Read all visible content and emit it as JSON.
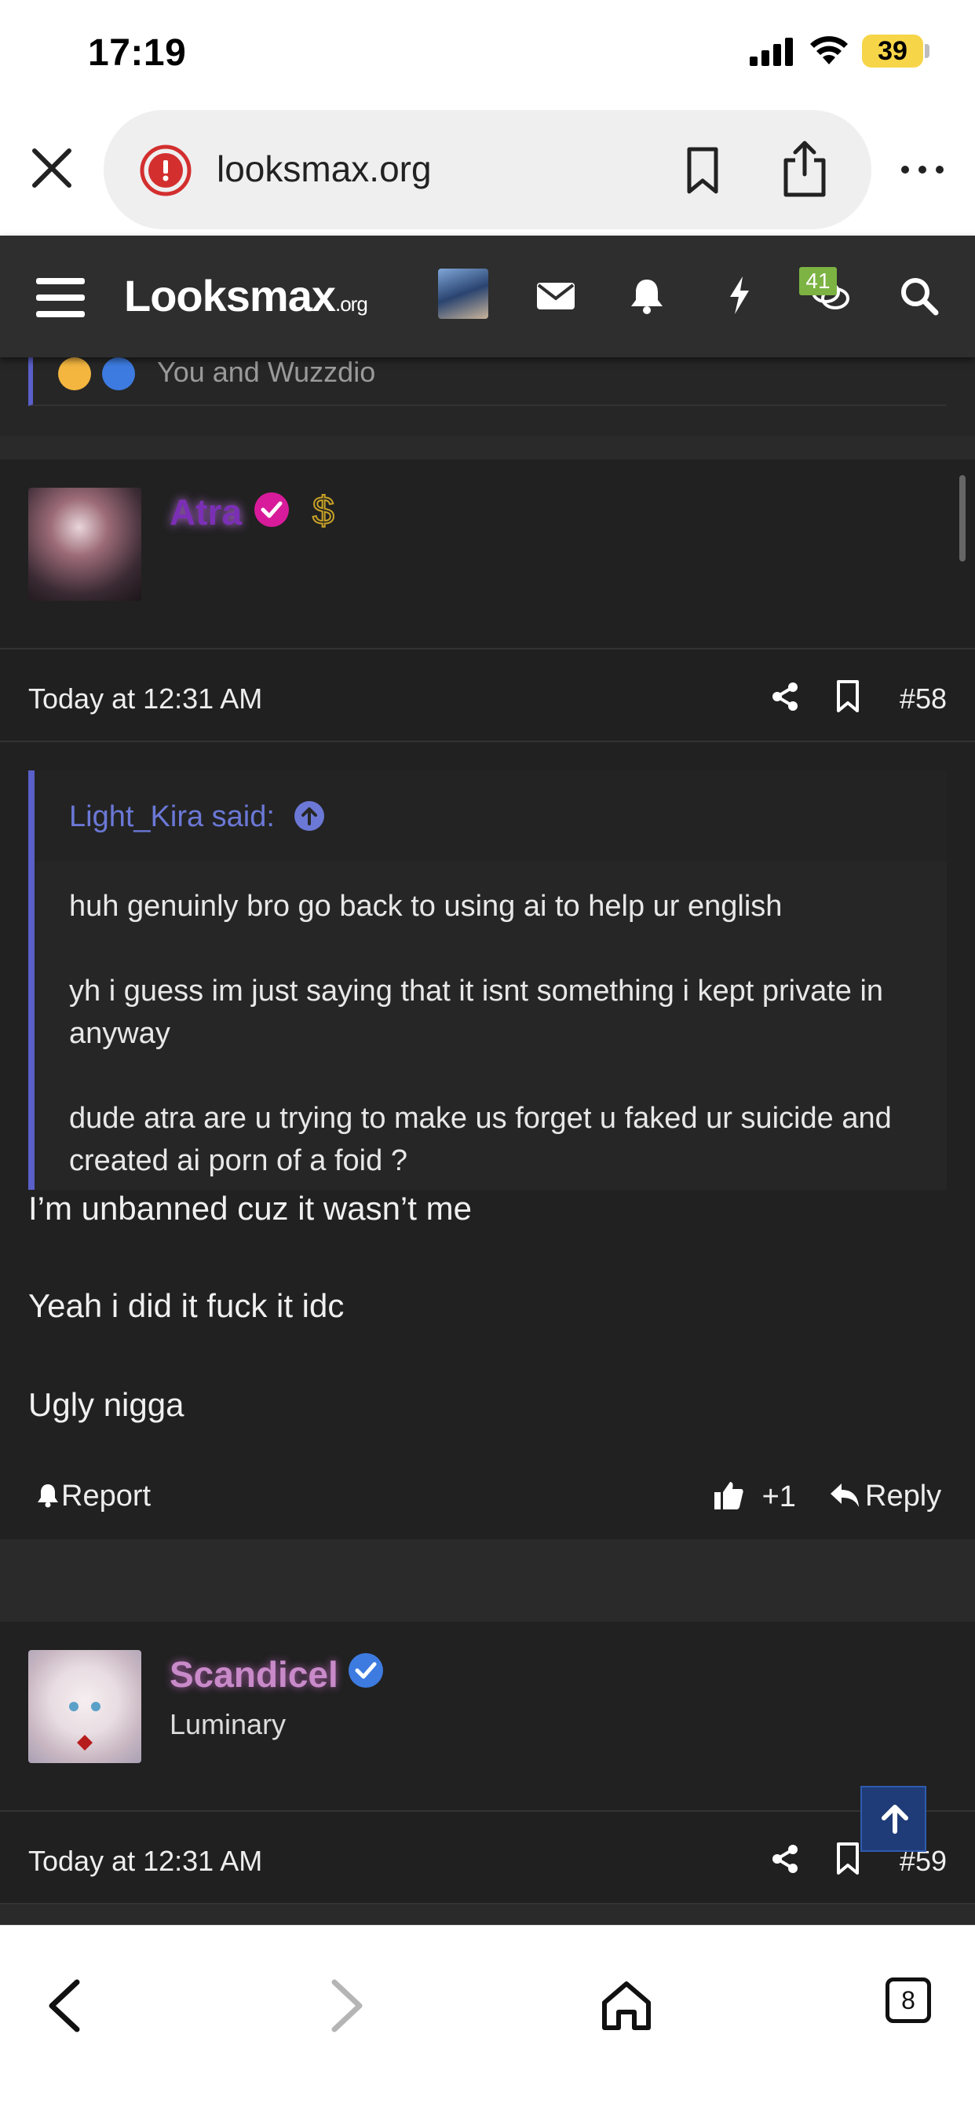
{
  "status_bar": {
    "time": "17:19",
    "battery": "39"
  },
  "browser": {
    "url": "looksmax.org"
  },
  "site": {
    "logo_main": "Looksmax",
    "logo_suffix": ".org",
    "conversations_badge": "41"
  },
  "previous_post": {
    "reactions_text": "You and Wuzzdio"
  },
  "posts": [
    {
      "username": "Atra",
      "user_title": "",
      "date": "Today at 12:31 AM",
      "post_number": "#58",
      "quote": {
        "author": "Light_Kira said:",
        "paragraphs": [
          "huh genuinly bro go back to using ai to help ur english",
          "yh i guess im just saying that it isnt something i kept private in anyway",
          "dude atra are u trying to make us forget u faked ur suicide and created ai porn of a foid ?"
        ]
      },
      "body": [
        "I’m unbanned cuz it wasn’t me",
        "Yeah i did it fuck it idc",
        "Ugly nigga"
      ],
      "report_label": "Report",
      "like_count": "+1",
      "reply_label": "Reply",
      "name_color": "#7b2fb5"
    },
    {
      "username": "Scandicel",
      "user_title": "Luminary",
      "date": "Today at 12:31 AM",
      "post_number": "#59",
      "name_color": "#c98ac9"
    }
  ],
  "bottom_bar": {
    "tab_count": "8"
  },
  "colors": {
    "accent": "#5a5fc9",
    "verified_pink": "#d81b9a",
    "verified_blue": "#3d7be0"
  }
}
